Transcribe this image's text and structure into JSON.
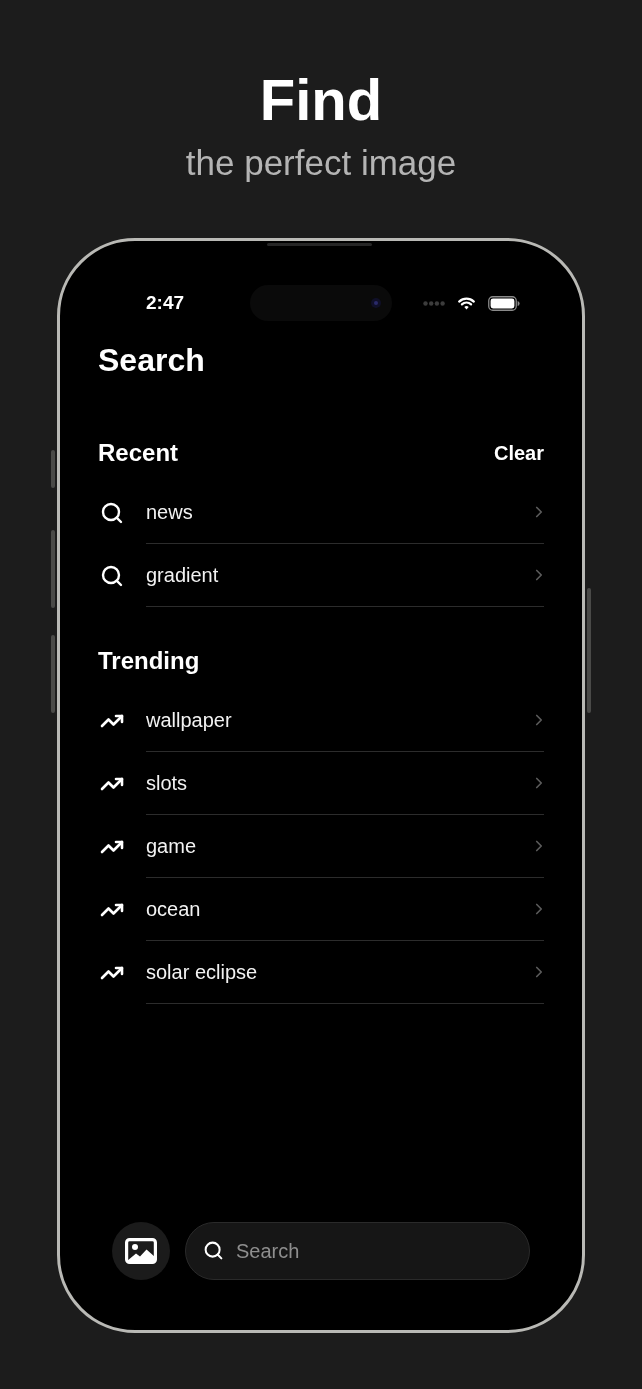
{
  "header": {
    "title": "Find",
    "subtitle": "the perfect image"
  },
  "status_bar": {
    "time": "2:47"
  },
  "screen": {
    "title": "Search"
  },
  "sections": [
    {
      "kind": "recent",
      "title": "Recent",
      "action": "Clear",
      "items": [
        "news",
        "gradient"
      ]
    },
    {
      "kind": "trending",
      "title": "Trending",
      "items": [
        "wallpaper",
        "slots",
        "game",
        "ocean",
        "solar eclipse"
      ]
    }
  ],
  "search_field": {
    "placeholder": "Search"
  }
}
